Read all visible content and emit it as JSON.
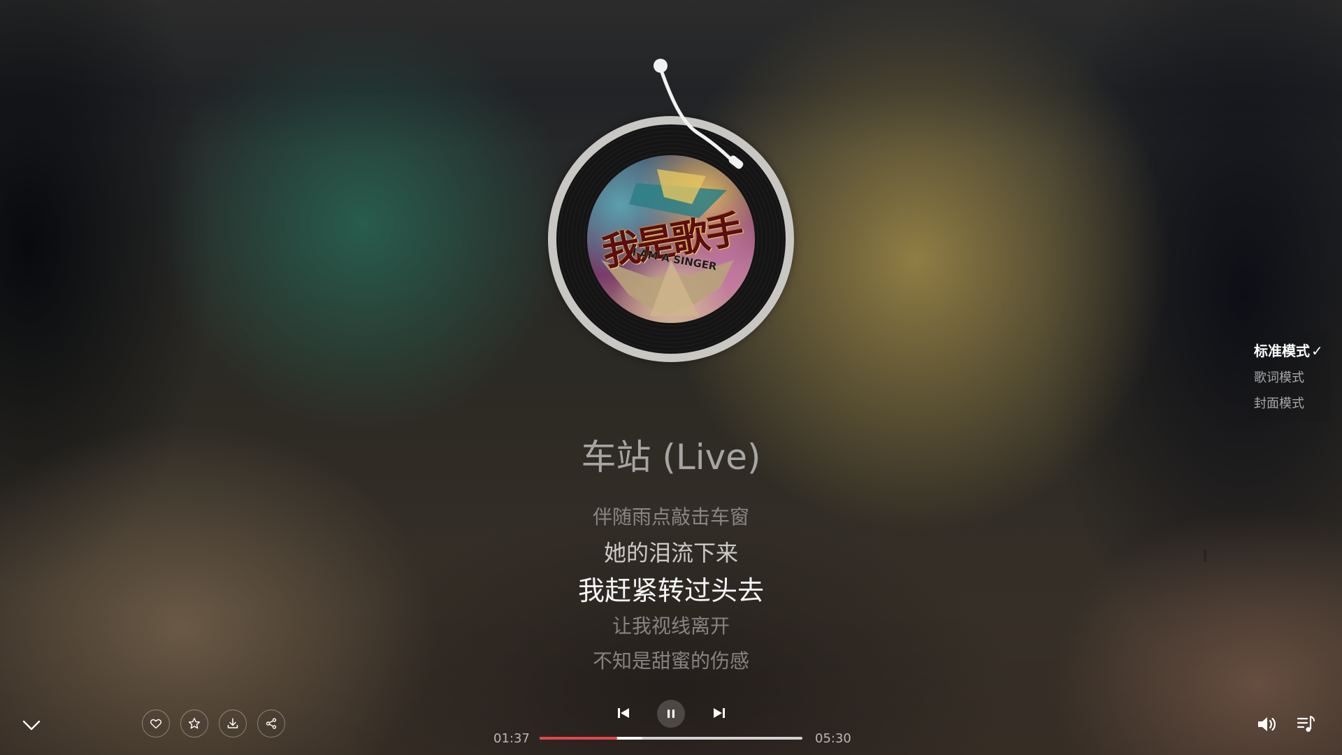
{
  "song": {
    "title": "车站 (Live)",
    "cover": {
      "title_text": "我是歌手",
      "subtitle_text": "I AM A SINGER"
    }
  },
  "lyrics": [
    {
      "text": "伴随雨点敲击车窗",
      "state": "past"
    },
    {
      "text": "她的泪流下来",
      "state": "previous"
    },
    {
      "text": "我赶紧转过头去",
      "state": "current"
    },
    {
      "text": "让我视线离开",
      "state": "upcoming"
    },
    {
      "text": "不知是甜蜜的伤感",
      "state": "upcoming"
    }
  ],
  "mode_menu": {
    "items": [
      {
        "label": "标准模式",
        "selected": true,
        "check": "✓"
      },
      {
        "label": "歌词模式",
        "selected": false
      },
      {
        "label": "封面模式",
        "selected": false
      }
    ]
  },
  "playback": {
    "current_time": "01:37",
    "total_time": "05:30",
    "progress_fraction": 0.294,
    "buffered_fraction": 0.39,
    "state": "playing",
    "accent_color": "#e04848"
  },
  "icons": {
    "collapse": "chevron-down-icon",
    "like": "heart-icon",
    "favorite": "star-icon",
    "download": "download-icon",
    "share": "share-icon",
    "previous": "skip-previous-icon",
    "pause": "pause-icon",
    "next": "skip-next-icon",
    "volume": "volume-icon",
    "playlist": "playlist-icon"
  }
}
